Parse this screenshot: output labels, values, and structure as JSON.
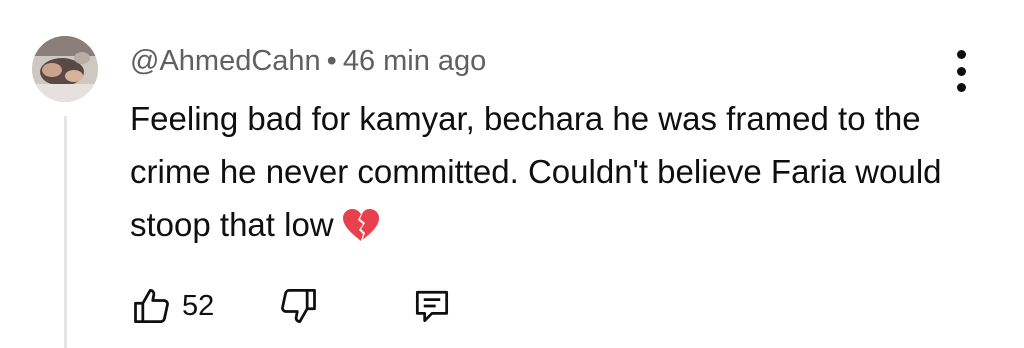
{
  "comment": {
    "author": "@AhmedCahn",
    "separator": "•",
    "timestamp": "46 min ago",
    "text": "Feeling bad for kamyar, bechara he was framed to the crime he never committed. Couldn't believe Faria would stoop that low",
    "emoji": "broken-heart",
    "like_count": "52"
  },
  "icons": {
    "more": "more-vert-icon",
    "like": "thumbs-up-icon",
    "dislike": "thumbs-down-icon",
    "reply": "reply-comment-icon"
  },
  "colors": {
    "text": "#0f0f0f",
    "meta": "#606060",
    "heart": "#e8404d"
  }
}
